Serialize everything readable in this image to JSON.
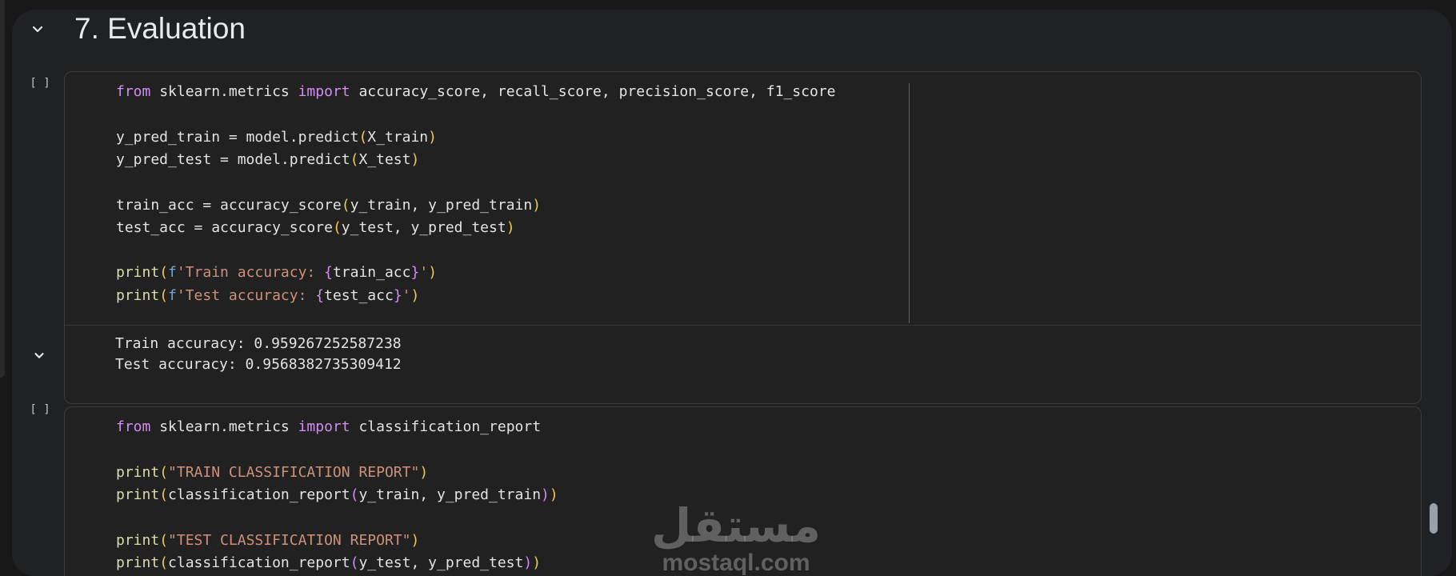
{
  "section": {
    "title": "7. Evaluation"
  },
  "cells": [
    {
      "run_indicator": "[ ]",
      "code_lines": [
        [
          [
            "kw",
            "from"
          ],
          [
            "plain",
            " sklearn.metrics "
          ],
          [
            "kw",
            "import"
          ],
          [
            "plain",
            " accuracy_score, recall_score, precision_score, f1_score"
          ]
        ],
        [],
        [
          [
            "plain",
            "y_pred_train = model.predict"
          ],
          [
            "br",
            "("
          ],
          [
            "plain",
            "X_train"
          ],
          [
            "br",
            ")"
          ]
        ],
        [
          [
            "plain",
            "y_pred_test = model.predict"
          ],
          [
            "br",
            "("
          ],
          [
            "plain",
            "X_test"
          ],
          [
            "br",
            ")"
          ]
        ],
        [],
        [
          [
            "plain",
            "train_acc = accuracy_score"
          ],
          [
            "br",
            "("
          ],
          [
            "plain",
            "y_train, y_pred_train"
          ],
          [
            "br",
            ")"
          ]
        ],
        [
          [
            "plain",
            "test_acc = accuracy_score"
          ],
          [
            "br",
            "("
          ],
          [
            "plain",
            "y_test, y_pred_test"
          ],
          [
            "br",
            ")"
          ]
        ],
        [],
        [
          [
            "fn",
            "print"
          ],
          [
            "br",
            "("
          ],
          [
            "pf",
            "f"
          ],
          [
            "str",
            "'Train accuracy: "
          ],
          [
            "kw",
            "{"
          ],
          [
            "plain",
            "train_acc"
          ],
          [
            "kw",
            "}"
          ],
          [
            "str",
            "'"
          ],
          [
            "br",
            ")"
          ]
        ],
        [
          [
            "fn",
            "print"
          ],
          [
            "br",
            "("
          ],
          [
            "pf",
            "f"
          ],
          [
            "str",
            "'Test accuracy: "
          ],
          [
            "kw",
            "{"
          ],
          [
            "plain",
            "test_acc"
          ],
          [
            "kw",
            "}"
          ],
          [
            "str",
            "'"
          ],
          [
            "br",
            ")"
          ]
        ]
      ],
      "output": {
        "line1": "Train accuracy: 0.959267252587238",
        "line2": "Test accuracy: 0.9568382735309412"
      }
    },
    {
      "run_indicator": "[ ]",
      "code_lines": [
        [
          [
            "kw",
            "from"
          ],
          [
            "plain",
            " sklearn.metrics "
          ],
          [
            "kw",
            "import"
          ],
          [
            "plain",
            " classification_report"
          ]
        ],
        [],
        [
          [
            "fn",
            "print"
          ],
          [
            "br",
            "("
          ],
          [
            "str",
            "\"TRAIN CLASSIFICATION REPORT\""
          ],
          [
            "br",
            ")"
          ]
        ],
        [
          [
            "fn",
            "print"
          ],
          [
            "br",
            "("
          ],
          [
            "plain",
            "classification_report"
          ],
          [
            "kw",
            "("
          ],
          [
            "plain",
            "y_train, y_pred_train"
          ],
          [
            "kw",
            ")"
          ],
          [
            "br",
            ")"
          ]
        ],
        [],
        [
          [
            "fn",
            "print"
          ],
          [
            "br",
            "("
          ],
          [
            "str",
            "\"TEST CLASSIFICATION REPORT\""
          ],
          [
            "br",
            ")"
          ]
        ],
        [
          [
            "fn",
            "print"
          ],
          [
            "br",
            "("
          ],
          [
            "plain",
            "classification_report"
          ],
          [
            "kw",
            "("
          ],
          [
            "plain",
            "y_test, y_pred_test"
          ],
          [
            "kw",
            ")"
          ],
          [
            "br",
            ")"
          ]
        ]
      ]
    }
  ],
  "watermark": {
    "arabic": "مستقل",
    "latin": "mostaql.com"
  },
  "icons": {
    "collapse": "chevron-down-icon",
    "output_toggle": "chevron-down-icon"
  },
  "colors": {
    "keyword": "#d18df0",
    "bracket": "#f2c94c",
    "string": "#ce9178",
    "text": "#e3e3e3",
    "background": "#202124"
  }
}
